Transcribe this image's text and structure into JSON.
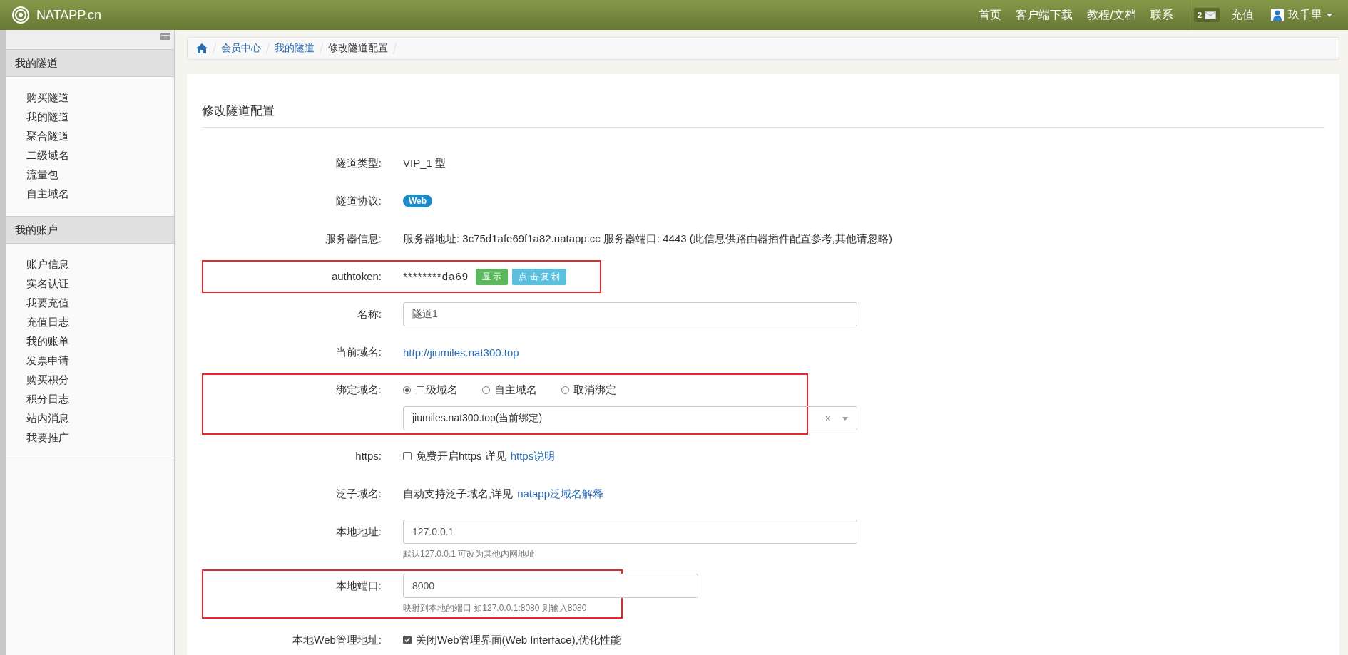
{
  "navbar": {
    "brand": "NATAPP.cn",
    "links": [
      "首页",
      "客户端下载",
      "教程/文档",
      "联系"
    ],
    "message_count": "2",
    "recharge": "充值",
    "user": "玖千里"
  },
  "sidebar": {
    "sections": [
      {
        "title": "我的隧道",
        "items": [
          "购买隧道",
          "我的隧道",
          "聚合隧道",
          "二级域名",
          "流量包",
          "自主域名"
        ]
      },
      {
        "title": "我的账户",
        "items": [
          "账户信息",
          "实名认证",
          "我要充值",
          "充值日志",
          "我的账单",
          "发票申请",
          "购买积分",
          "积分日志",
          "站内消息",
          "我要推广"
        ]
      }
    ]
  },
  "breadcrumb": [
    {
      "label": "会员中心",
      "kind": "link"
    },
    {
      "label": "我的隧道",
      "kind": "link"
    },
    {
      "label": "修改隧道配置",
      "kind": "current"
    }
  ],
  "form": {
    "title": "修改隧道配置",
    "rows": [
      {
        "kind": "text",
        "label": "隧道类型:",
        "value": "VIP_1 型",
        "highlighted": false
      },
      {
        "kind": "badge",
        "label": "隧道协议:",
        "value": "Web",
        "highlighted": false
      },
      {
        "kind": "text",
        "label": "服务器信息:",
        "value": "服务器地址: 3c75d1afe69f1a82.natapp.cc 服务器端口: 4443 (此信息供路由器插件配置参考,其他请忽略)",
        "highlighted": false
      },
      {
        "kind": "token",
        "label": "authtoken:",
        "value": "********da69",
        "buttons": [
          "显 示",
          "点 击 复 制"
        ],
        "highlighted": true
      },
      {
        "kind": "input",
        "label": "名称:",
        "value": "隧道1",
        "highlighted": false
      },
      {
        "kind": "link",
        "label": "当前域名:",
        "value": "http://jiumiles.nat300.top",
        "highlighted": false
      },
      {
        "kind": "radio",
        "label": "绑定域名:",
        "options": [
          {
            "label": "二级域名",
            "selected": true
          },
          {
            "label": "自主域名",
            "selected": false
          },
          {
            "label": "取消绑定",
            "selected": false
          }
        ],
        "select_value": "jiumiles.nat300.top(当前绑定)",
        "clear": "×",
        "highlighted": true
      },
      {
        "kind": "checkbox",
        "label": "https:",
        "checked": false,
        "text": "免费开启https 详见",
        "link": "https说明",
        "highlighted": false
      },
      {
        "kind": "textlink",
        "label": "泛子域名:",
        "text": "自动支持泛子域名,详见",
        "link": "natapp泛域名解释",
        "highlighted": false
      },
      {
        "kind": "input",
        "label": "本地地址:",
        "value": "127.0.0.1",
        "hint": "默认127.0.0.1 可改为其他内网地址",
        "highlighted": false
      },
      {
        "kind": "shortinput",
        "label": "本地端口:",
        "value": "8000",
        "hint": "映射到本地的端口 如127.0.0.1:8080 则输入8080",
        "highlighted": true
      },
      {
        "kind": "checkbox",
        "label": "本地Web管理地址:",
        "checked": true,
        "text": "关闭Web管理界面(Web Interface),优化性能",
        "highlighted": false
      }
    ]
  }
}
